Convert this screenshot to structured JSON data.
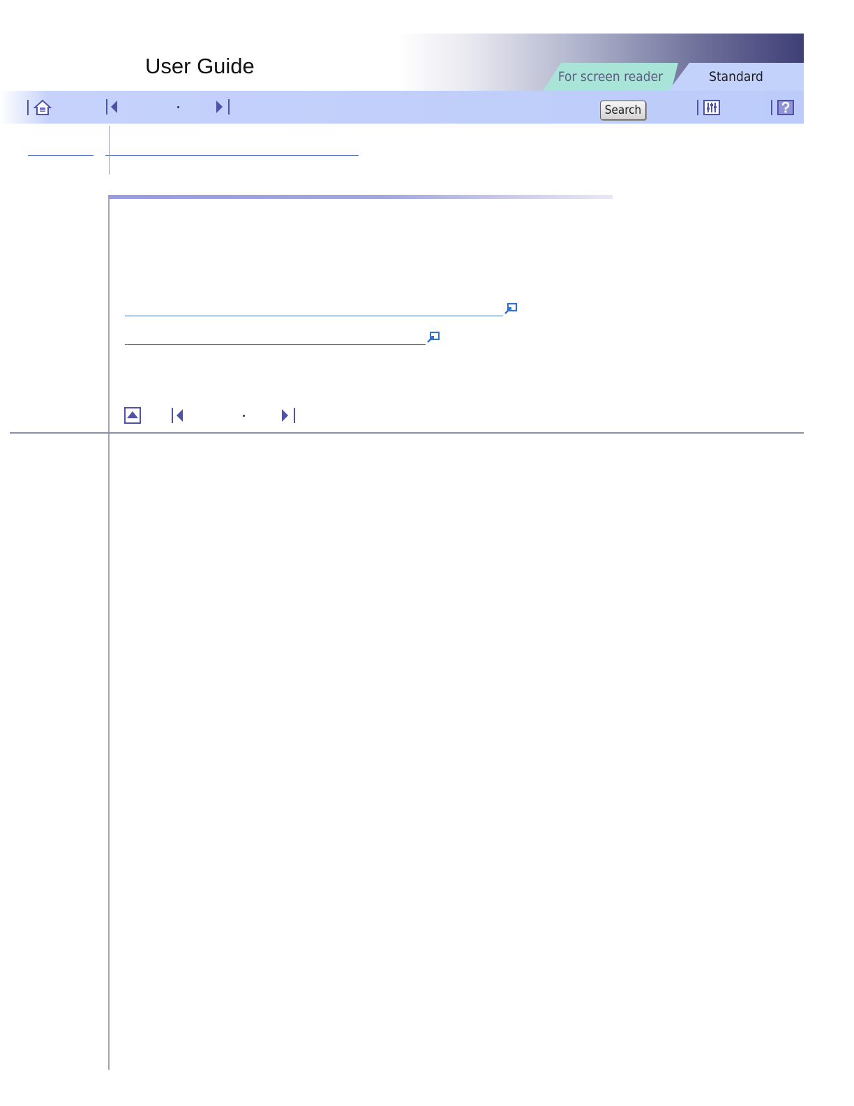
{
  "header": {
    "title": "User Guide",
    "tabs": [
      {
        "label": "For screen reader"
      },
      {
        "label": "Standard"
      }
    ]
  },
  "toolbar": {
    "search_label": "Search",
    "icons": [
      "home-icon",
      "previous-icon",
      "next-icon",
      "settings-icon",
      "help-icon"
    ]
  },
  "footer_nav": {
    "icons": [
      "top-icon",
      "previous-icon",
      "next-icon"
    ]
  },
  "colors": {
    "accent": "#4f53a8",
    "toolbar": "#bccbfa",
    "tab_reader": "#a9e4d8",
    "tab_standard": "#c3d2fb",
    "link": "#4b6fbf"
  }
}
